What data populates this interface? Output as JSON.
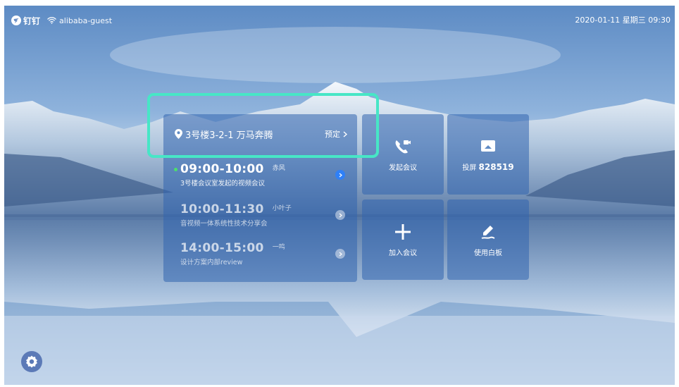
{
  "status": {
    "app_name": "钉钉",
    "wifi_name": "alibaba-guest",
    "datetime": "2020-01-11 星期三 09:30"
  },
  "schedule": {
    "room": "3号楼3-2-1 万马奔腾",
    "reserve_label": "预定",
    "meetings": [
      {
        "time": "09:00-10:00",
        "host": "赤风",
        "title": "3号楼会议室发起的视频会议",
        "active": true
      },
      {
        "time": "10:00-11:30",
        "host": "小叶子",
        "title": "音视频一体系统性技术分享会",
        "active": false
      },
      {
        "time": "14:00-15:00",
        "host": "一鸣",
        "title": "设计方案内部review",
        "active": false
      }
    ]
  },
  "tiles": {
    "start_meeting": "发起会议",
    "cast_label": "投屏",
    "cast_code": "828519",
    "join_meeting": "加入会议",
    "whiteboard": "使用白板"
  },
  "colors": {
    "highlight": "#47e6c6",
    "active_arrow": "#2f80f7",
    "live_dot": "#4be06b"
  },
  "icons": [
    "dingtalk-logo-icon",
    "wifi-icon",
    "location-pin-icon",
    "chevron-right-icon",
    "phone-video-icon",
    "cast-screen-icon",
    "plus-icon",
    "pen-icon",
    "gear-icon"
  ]
}
